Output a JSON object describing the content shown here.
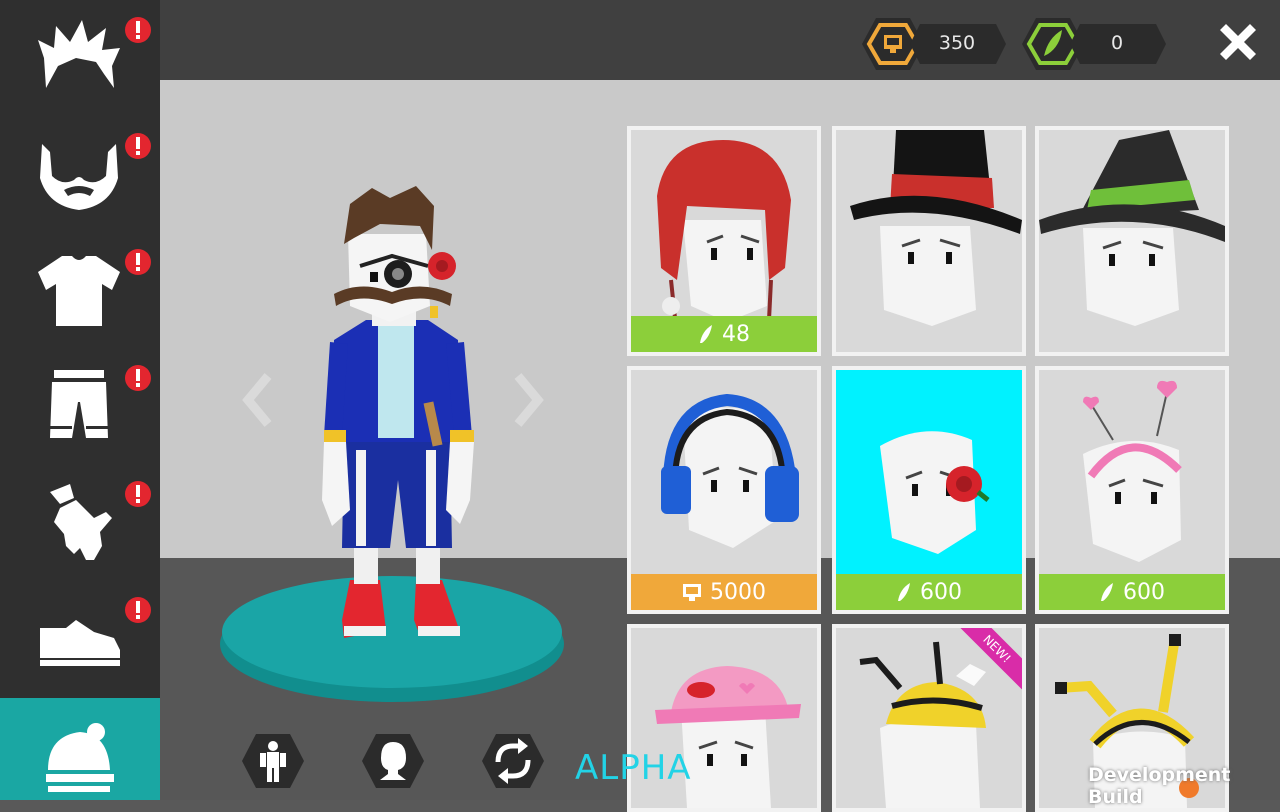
{
  "sidebar": {
    "categories": [
      {
        "icon": "hair-icon",
        "alert": true
      },
      {
        "icon": "beard-icon",
        "alert": true
      },
      {
        "icon": "shirt-icon",
        "alert": true
      },
      {
        "icon": "pants-icon",
        "alert": true
      },
      {
        "icon": "glove-icon",
        "alert": true
      },
      {
        "icon": "shoe-icon",
        "alert": true
      },
      {
        "icon": "hat-icon",
        "alert": false,
        "active": true
      }
    ],
    "alert_mark": "!"
  },
  "currency": {
    "coins": {
      "icon": "coin-icon",
      "value": "350"
    },
    "feathers": {
      "icon": "feather-icon",
      "value": "0"
    }
  },
  "close_icon": "close-icon",
  "preview": {
    "prev_icon": "chevron-left-icon",
    "next_icon": "chevron-right-icon"
  },
  "shop": {
    "items": [
      {
        "name": "red-aviator-cap",
        "price": "48",
        "currency": "feather",
        "selected": false
      },
      {
        "name": "red-band-top-hat",
        "price": "",
        "currency": "",
        "selected": false
      },
      {
        "name": "witch-hat",
        "price": "",
        "currency": "",
        "selected": false
      },
      {
        "name": "blue-headphones",
        "price": "5000",
        "currency": "coin",
        "selected": false
      },
      {
        "name": "rose-hair-clip",
        "price": "600",
        "currency": "feather",
        "selected": true
      },
      {
        "name": "heart-antenna-headband",
        "price": "600",
        "currency": "feather",
        "selected": false
      },
      {
        "name": "pink-lips-cap",
        "price": "",
        "currency": "",
        "selected": false
      },
      {
        "name": "bee-hat",
        "price": "",
        "currency": "",
        "selected": false,
        "badge": "NEW!"
      },
      {
        "name": "bee-antenna-helmet",
        "price": "",
        "currency": "",
        "selected": false
      }
    ]
  },
  "bottom_buttons": [
    {
      "icon": "body-icon"
    },
    {
      "icon": "head-icon"
    },
    {
      "icon": "rotate-icon"
    }
  ],
  "alpha_label": "ALPHA",
  "dev_build_label": "Development Build",
  "colors": {
    "sidebar_bg": "#2f2f2f",
    "active_tab": "#1aa7a3",
    "alert_red": "#e3262f",
    "price_green": "#8ccf3a",
    "price_orange": "#f0a83a",
    "selected_tile": "#00f2ff",
    "new_badge": "#d92ca8",
    "alpha_cyan": "#22d3e6"
  }
}
